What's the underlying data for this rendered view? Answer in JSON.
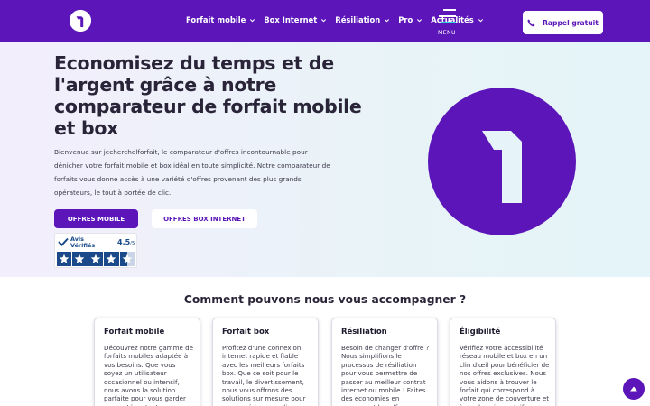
{
  "header": {
    "nav": [
      {
        "label": "Forfait mobile"
      },
      {
        "label": "Box Internet"
      },
      {
        "label": "Résiliation"
      },
      {
        "label": "Pro"
      },
      {
        "label": "Actualités"
      }
    ],
    "menu_label": "MENU",
    "rappel_label": "Rappel gratuit"
  },
  "hero": {
    "title": "Economisez du temps et de l'argent grâce à notre comparateur de forfait mobile et box",
    "description": "Bienvenue sur jecherchelforfait, le comparateur d'offres incontournable pour dénicher votre forfait mobile et box idéal en toute simplicité. Notre comparateur de forfaits vous donne accès à une variété d'offres provenant des plus grands opérateurs, le tout à portée de clic.",
    "btn_mobile": "OFFRES MOBILE",
    "btn_box": "OFFRES BOX INTERNET",
    "avis": {
      "name": "Avis\nVérifiés",
      "score": "4.5",
      "max": "/5",
      "rating": 4.5
    }
  },
  "section": {
    "title": "Comment pouvons nous vous accompagner ?",
    "cards": [
      {
        "title": "Forfait mobile",
        "body": "Découvrez notre gamme de forfaits mobiles adaptée à vos besoins. Que vous soyez un utilisateur occasionnel ou intensif, nous avons la solution parfaite pour vous garder connecté en tout"
      },
      {
        "title": "Forfait box",
        "body": "Profitez d'une connexion internet rapide et fiable avec les meilleurs forfaits box. Que ce soit pour le travail, le divertissement, nous vous offrons des solutions sur mesure pour une expérience en ligne"
      },
      {
        "title": "Résiliation",
        "body": "Besoin de changer d'offre ? Nous simplifions le processus de résiliation pour vous permettre de passer au meilleur contrat internet ou mobile ! Faites des économies en comparant les offres"
      },
      {
        "title": "Éligibilité",
        "body": "Vérifiez votre accessibilité réseau mobile et box en un clin d'œil pour bénéficier de nos offres exclusives. Nous vous aidons à trouver le forfait qui correspond à votre zone de couverture et à vos besoins spécifiques"
      }
    ]
  },
  "colors": {
    "brand": "#5b15b8",
    "avis_blue": "#1a4a8a"
  },
  "icons": {
    "logo": "number-one-logo",
    "nav_chevron": "chevron-down-icon",
    "phone": "phone-icon",
    "menu": "hamburger-icon",
    "scroll_top": "arrow-up-icon"
  }
}
